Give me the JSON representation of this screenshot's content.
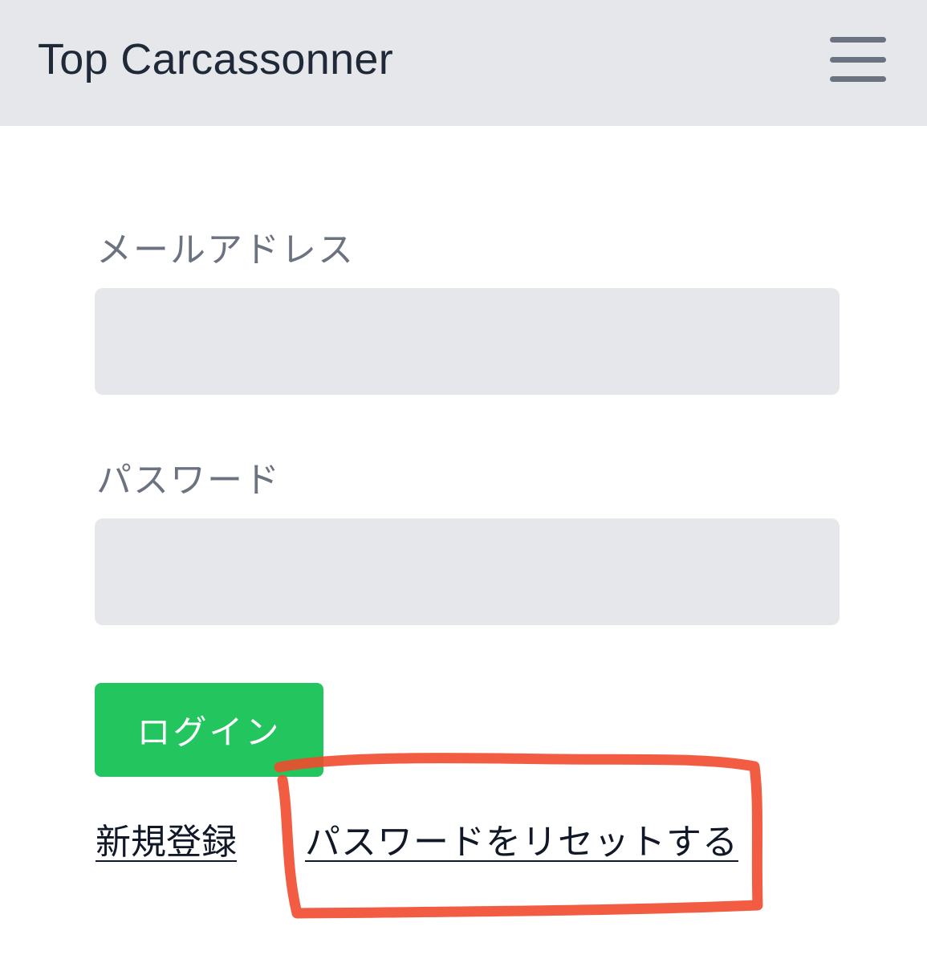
{
  "navbar": {
    "brand": "Top Carcassonner",
    "menu_icon": "hamburger-menu-icon"
  },
  "form": {
    "email_label": "メールアドレス",
    "email_value": "",
    "password_label": "パスワード",
    "password_value": "",
    "login_label": "ログイン"
  },
  "links": {
    "register": "新規登録",
    "reset_password": "パスワードをリセットする"
  },
  "colors": {
    "navbar_bg": "#e5e7eb",
    "input_bg": "#e5e7eb",
    "login_button": "#22c55e",
    "label_text": "#6b7280",
    "annotation": "#ef4a2e"
  }
}
